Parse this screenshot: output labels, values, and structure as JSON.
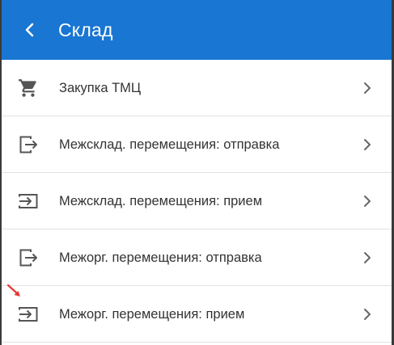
{
  "header": {
    "title": "Склад",
    "back_icon": "chevron-left-icon",
    "background_color": "#1976d2"
  },
  "menu": {
    "items": [
      {
        "label": "Закупка ТМЦ",
        "icon": "shopping-cart-icon"
      },
      {
        "label": "Межсклад. перемещения: отправка",
        "icon": "export-icon"
      },
      {
        "label": "Межсклад. перемещения: прием",
        "icon": "import-icon"
      },
      {
        "label": "Межорг. перемещения: отправка",
        "icon": "export-icon"
      },
      {
        "label": "Межорг. перемещения: прием",
        "icon": "import-icon"
      }
    ],
    "chevron_icon": "chevron-right-icon"
  },
  "annotation": {
    "color": "#e53935",
    "icon": "red-arrow-icon"
  }
}
